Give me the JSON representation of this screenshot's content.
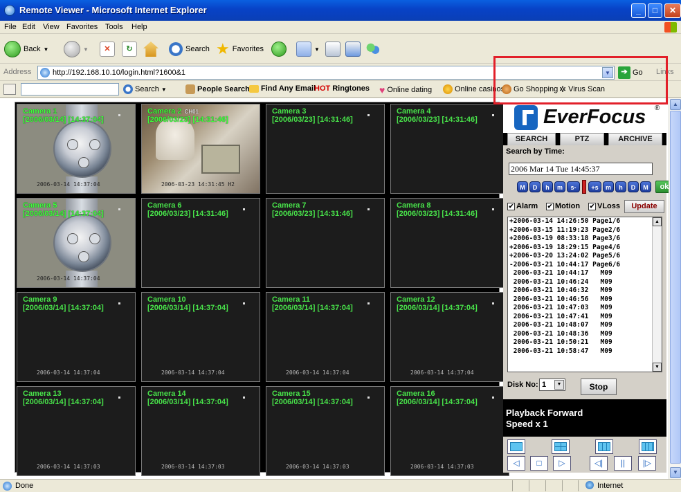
{
  "window": {
    "title": "Remote Viewer - Microsoft Internet Explorer"
  },
  "menu": [
    "File",
    "Edit",
    "View",
    "Favorites",
    "Tools",
    "Help"
  ],
  "toolbar": {
    "back": "Back",
    "search": "Search",
    "favorites": "Favorites"
  },
  "address": {
    "label": "Address",
    "url": "http://192.168.10.10/login.html?1600&1",
    "go": "Go",
    "links": "Links"
  },
  "searchbar": {
    "search": "Search",
    "people_search": "People Search",
    "find_email": "Find Any Email",
    "hot": "HOT",
    "ringtones": "Ringtones",
    "dating": "Online dating",
    "casinos": "Online casinos",
    "shopping": "Go Shopping",
    "virus": "Virus Scan"
  },
  "cameras": [
    {
      "name": "Camera 1",
      "date": "[2006/03/14] [14:37:04]",
      "overlay": "2006-03-14  14:37:04"
    },
    {
      "name": "Camera 2",
      "date": "[2006/03/23] [14:31:46]",
      "tag": "CH01",
      "overlay": "2006-03-23  14:31:45  H2"
    },
    {
      "name": "Camera 3",
      "date": "[2006/03/23] [14:31:46]",
      "overlay": ""
    },
    {
      "name": "Camera 4",
      "date": "[2006/03/23] [14:31:46]",
      "overlay": ""
    },
    {
      "name": "Camera 5",
      "date": "[2006/03/14] [14:37:04]",
      "overlay": "2006-03-14  14:37:04"
    },
    {
      "name": "Camera 6",
      "date": "[2006/03/23] [14:31:46]",
      "overlay": ""
    },
    {
      "name": "Camera 7",
      "date": "[2006/03/23] [14:31:46]",
      "overlay": ""
    },
    {
      "name": "Camera 8",
      "date": "[2006/03/23] [14:31:46]",
      "overlay": ""
    },
    {
      "name": "Camera 9",
      "date": "[2006/03/14] [14:37:04]",
      "overlay": "2006-03-14  14:37:04"
    },
    {
      "name": "Camera 10",
      "date": "[2006/03/14] [14:37:04]",
      "overlay": "2006-03-14  14:37:04"
    },
    {
      "name": "Camera 11",
      "date": "[2006/03/14] [14:37:04]",
      "overlay": "2006-03-14  14:37:04"
    },
    {
      "name": "Camera 12",
      "date": "[2006/03/14] [14:37:04]",
      "overlay": "2006-03-14  14:37:04"
    },
    {
      "name": "Camera 13",
      "date": "[2006/03/14] [14:37:04]",
      "overlay": "2006-03-14  14:37:03"
    },
    {
      "name": "Camera 14",
      "date": "[2006/03/14] [14:37:04]",
      "overlay": "2006-03-14  14:37:03"
    },
    {
      "name": "Camera 15",
      "date": "[2006/03/14] [14:37:04]",
      "overlay": "2006-03-14  14:37:03"
    },
    {
      "name": "Camera 16",
      "date": "[2006/03/14] [14:37:04]",
      "overlay": "2006-03-14  14:37:03"
    }
  ],
  "panel": {
    "brand": "EverFocus",
    "tabs": [
      "SEARCH",
      "PTZ",
      "ARCHIVE"
    ],
    "search_title": "Search by Time:",
    "time_value": "2006 Mar 14 Tue 14:45:37",
    "time_buttons": [
      "M",
      "D",
      "h",
      "m",
      "s-",
      "+s",
      "m",
      "h",
      "D",
      "M"
    ],
    "ok": "ok",
    "filters": [
      "Alarm",
      "Motion",
      "VLoss"
    ],
    "update": "Update",
    "events": [
      "+2006-03-14 14:26:50 Page1/6",
      "+2006-03-15 11:19:23 Page2/6",
      "+2006-03-19 08:33:18 Page3/6",
      "+2006-03-19 18:29:15 Page4/6",
      "+2006-03-20 13:24:02 Page5/6",
      "-2006-03-21 10:44:17 Page6/6",
      " 2006-03-21 10:44:17   M09",
      " 2006-03-21 10:46:24   M09",
      " 2006-03-21 10:46:32   M09",
      " 2006-03-21 10:46:56   M09",
      " 2006-03-21 10:47:03   M09",
      " 2006-03-21 10:47:41   M09",
      " 2006-03-21 10:48:07   M09",
      " 2006-03-21 10:48:36   M09",
      " 2006-03-21 10:50:21   M09",
      " 2006-03-21 10:58:47   M09"
    ],
    "disk_label": "Disk No:",
    "disk_value": "1",
    "stop": "Stop",
    "status_line1": "Playback Forward",
    "status_line2": "Speed x 1"
  },
  "statusbar": {
    "text": "Done",
    "zone": "Internet"
  },
  "colors": {
    "camera_text": "#48e34a",
    "highlight": "#e2202a",
    "titlebar": "#0842c6"
  }
}
